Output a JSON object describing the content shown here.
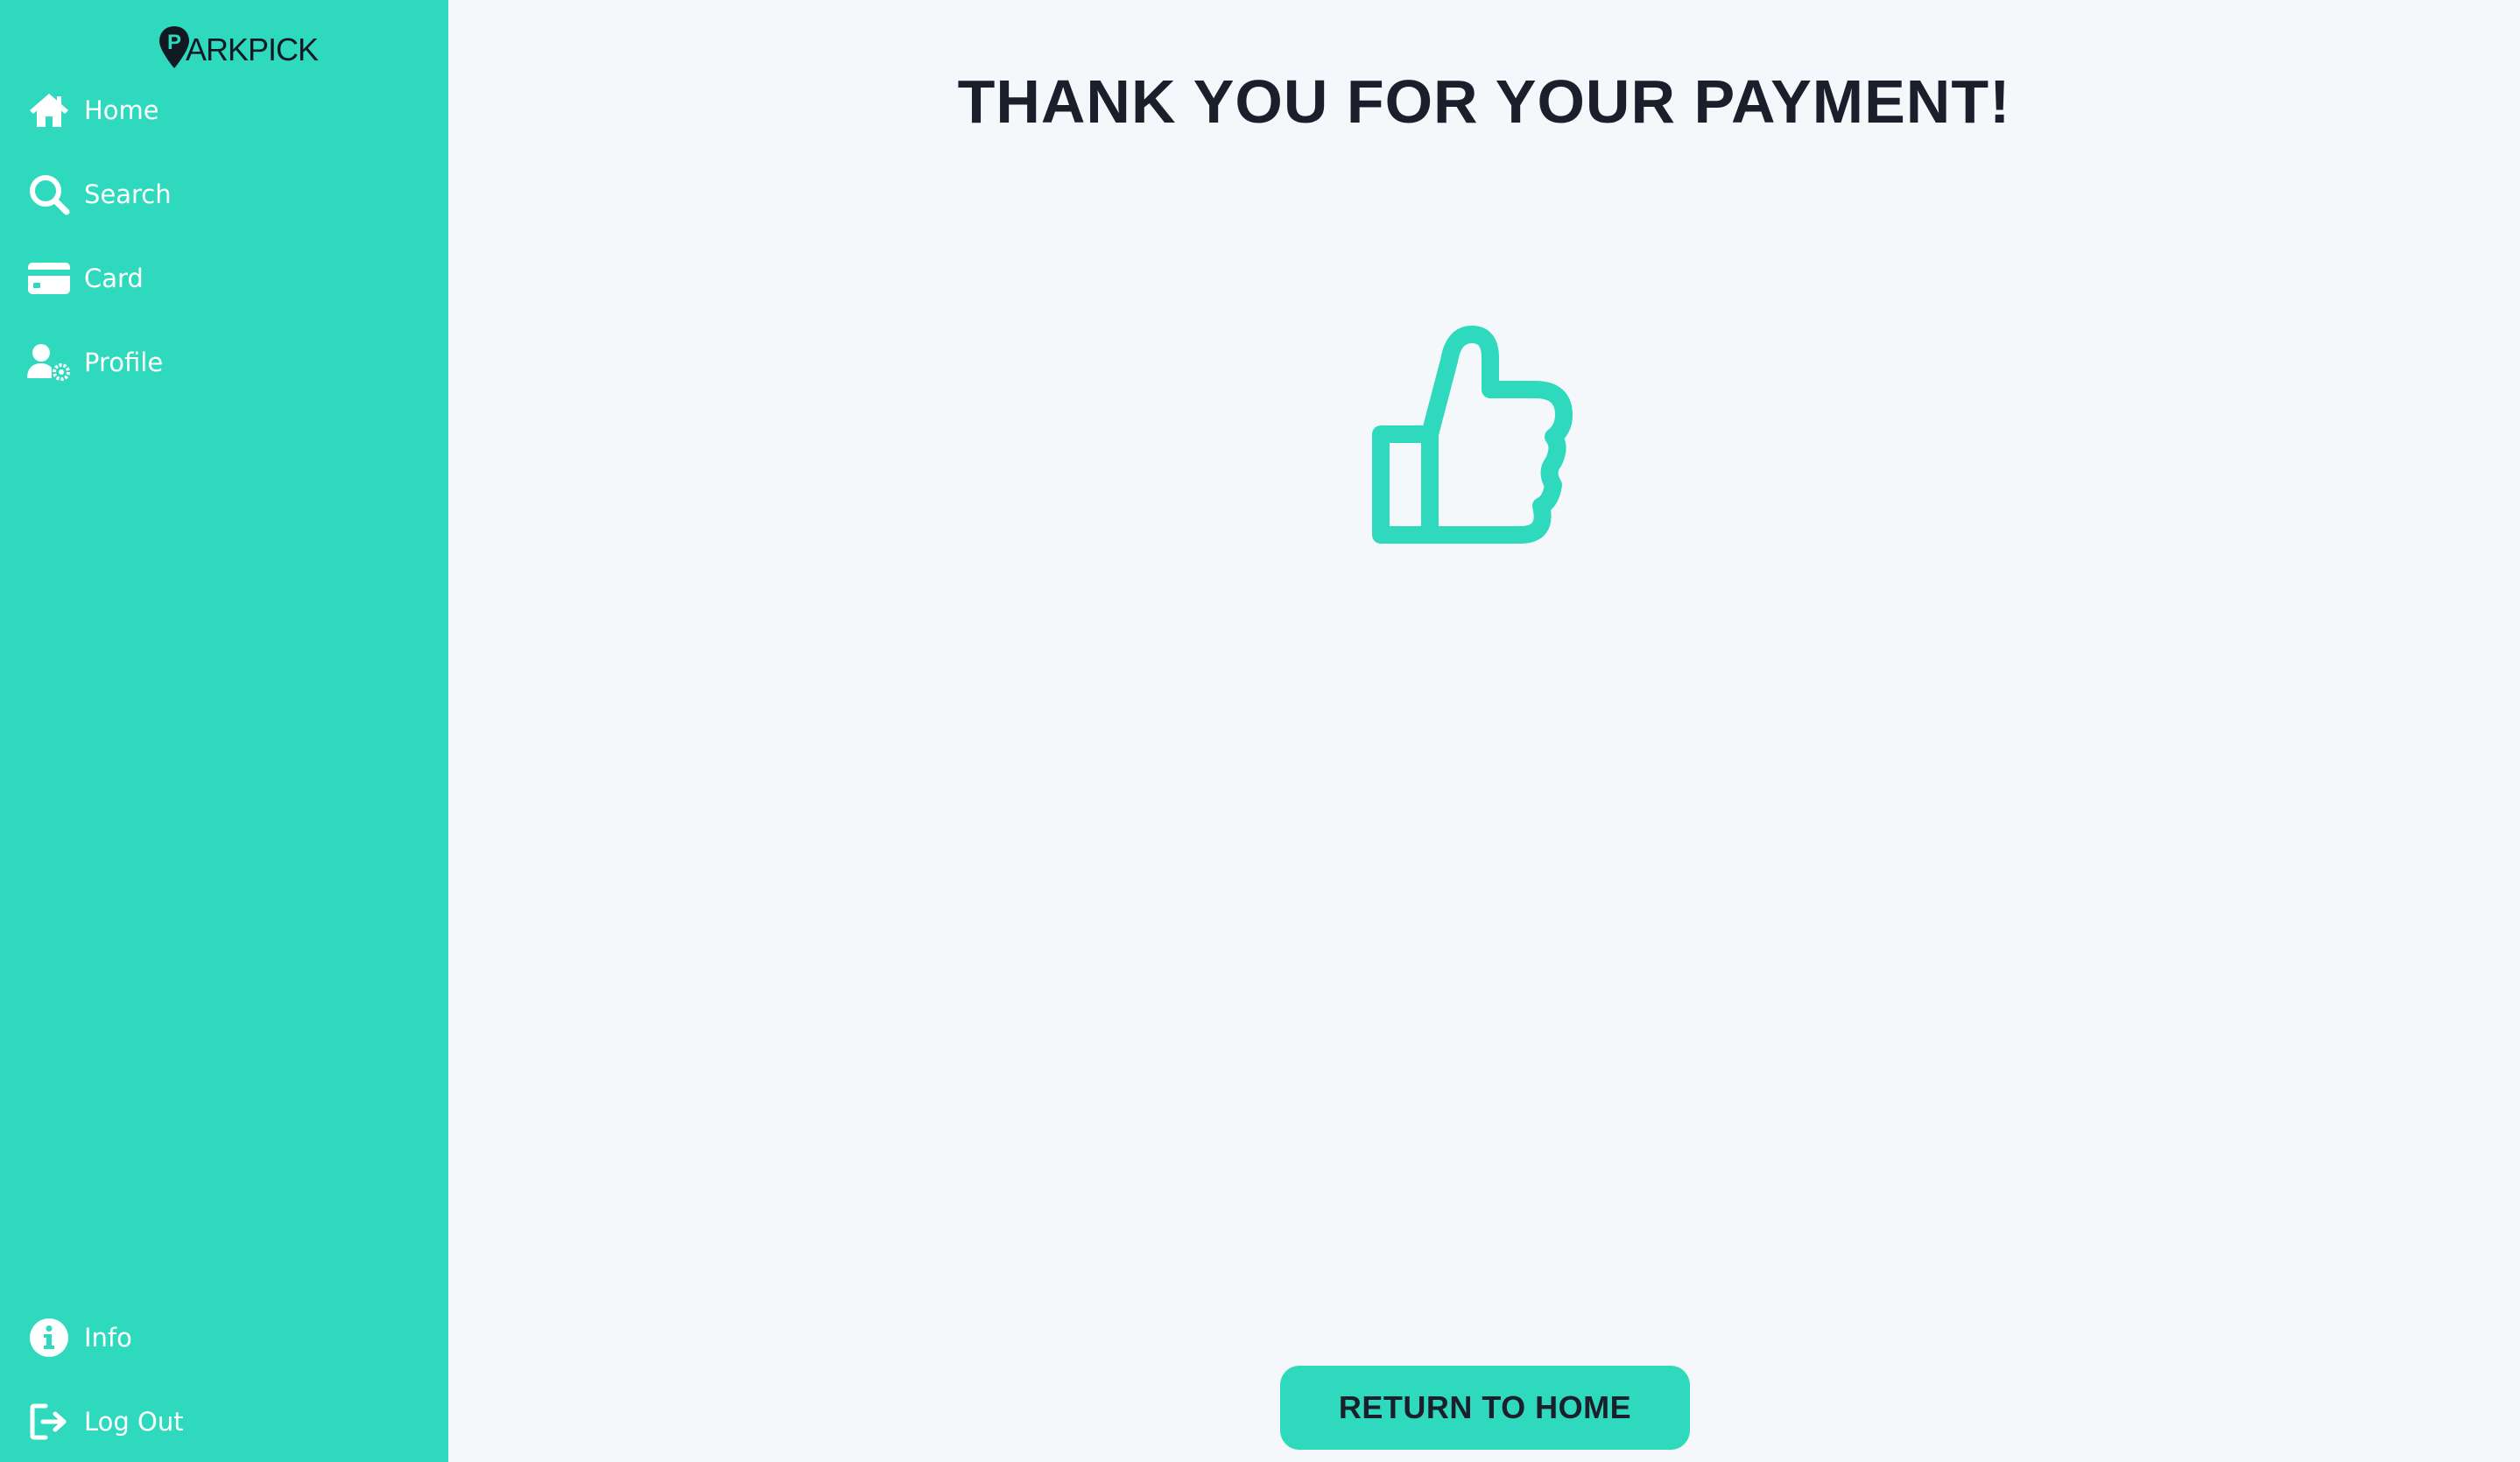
{
  "app": {
    "logo_text": "ARKPICK",
    "logo_letter": "P"
  },
  "colors": {
    "accent": "#2ed9be",
    "background": "#f4f8fb",
    "text_dark": "#1b1f2b",
    "nav_text": "#ffffff"
  },
  "sidebar": {
    "items": [
      {
        "label": "Home",
        "icon": "home-icon"
      },
      {
        "label": "Search",
        "icon": "search-icon"
      },
      {
        "label": "Card",
        "icon": "credit-card-icon"
      },
      {
        "label": "Profile",
        "icon": "user-settings-icon"
      }
    ],
    "bottom_items": [
      {
        "label": "Info",
        "icon": "info-icon"
      },
      {
        "label": "Log Out",
        "icon": "logout-icon"
      }
    ]
  },
  "main": {
    "title": "THANK YOU FOR YOUR PAYMENT!",
    "illustration": "thumbs-up-icon",
    "return_button": "RETURN TO HOME"
  }
}
